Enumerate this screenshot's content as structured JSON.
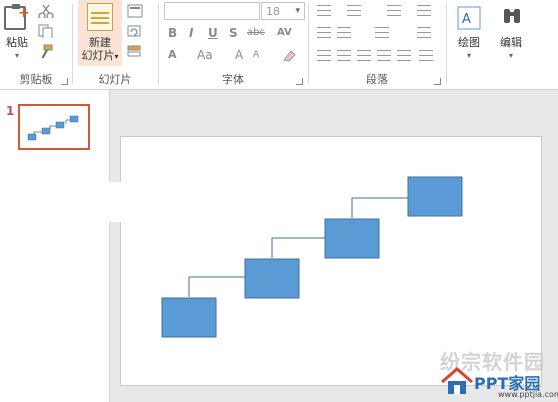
{
  "ribbon": {
    "clipboard": {
      "paste_label": "粘贴",
      "group_label": "剪贴板"
    },
    "slides": {
      "new_slide_label_line1": "新建",
      "new_slide_label_line2": "幻灯片",
      "group_label": "幻灯片"
    },
    "font": {
      "font_name_value": "",
      "font_size_value": "18",
      "group_label": "字体",
      "bold": "B",
      "italic": "I",
      "underline": "U",
      "shadow": "S",
      "strike": "abc",
      "spacing": "AV",
      "grow": "A",
      "shrink": "A",
      "case": "Aa",
      "color": "A"
    },
    "paragraph": {
      "group_label": "段落"
    },
    "drawing": {
      "label": "绘图"
    },
    "editing": {
      "label": "编辑"
    }
  },
  "thumbnails": {
    "slide_number": "1"
  },
  "watermark": {
    "text": "纷宗软件园",
    "brand": "PPT家园",
    "url": "www.pptjia.com"
  },
  "colors": {
    "box_fill": "#5b9bd5",
    "box_stroke": "#41719c",
    "connector": "#41719c",
    "thumb_border": "#d3583a"
  }
}
